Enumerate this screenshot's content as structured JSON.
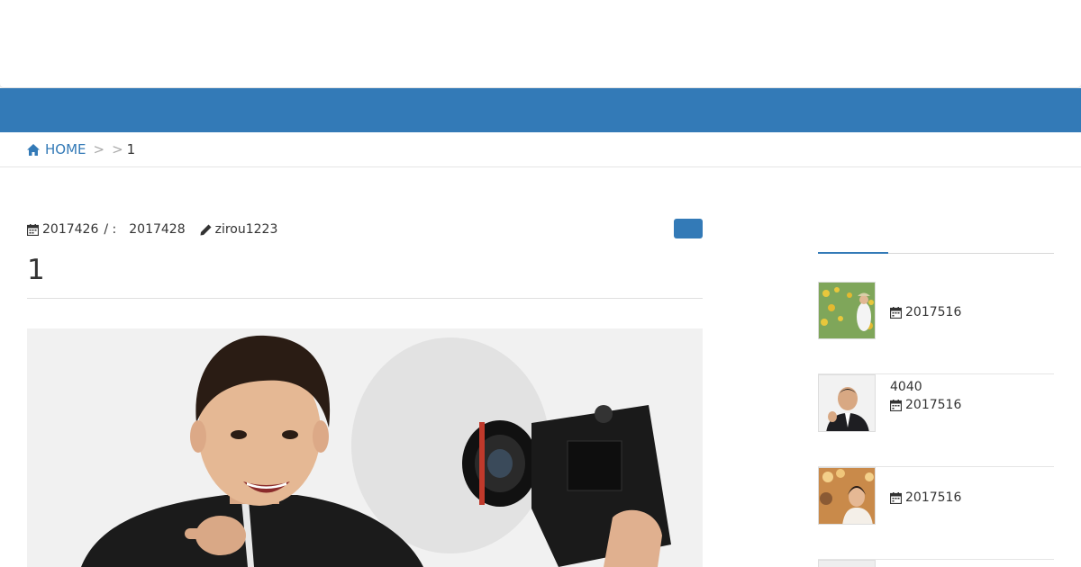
{
  "breadcrumb": {
    "home_label": "HOME",
    "sep1": ">",
    "sep2": ">",
    "current": "1"
  },
  "article": {
    "published_date": "2017426",
    "date_separator": "/ :",
    "updated_date": "2017428",
    "author": "zirou1223",
    "title": "1"
  },
  "sidebar": {
    "posts": [
      {
        "title": "",
        "date": "2017516",
        "thumb": "sunflower-field-photo"
      },
      {
        "title": "4040",
        "date": "2017516",
        "thumb": "businessman-photo"
      },
      {
        "title": "",
        "date": "2017516",
        "thumb": "party-woman-photo"
      }
    ]
  },
  "colors": {
    "brand_blue": "#337ab7",
    "text": "#333333",
    "divider": "#e5e5e5"
  }
}
